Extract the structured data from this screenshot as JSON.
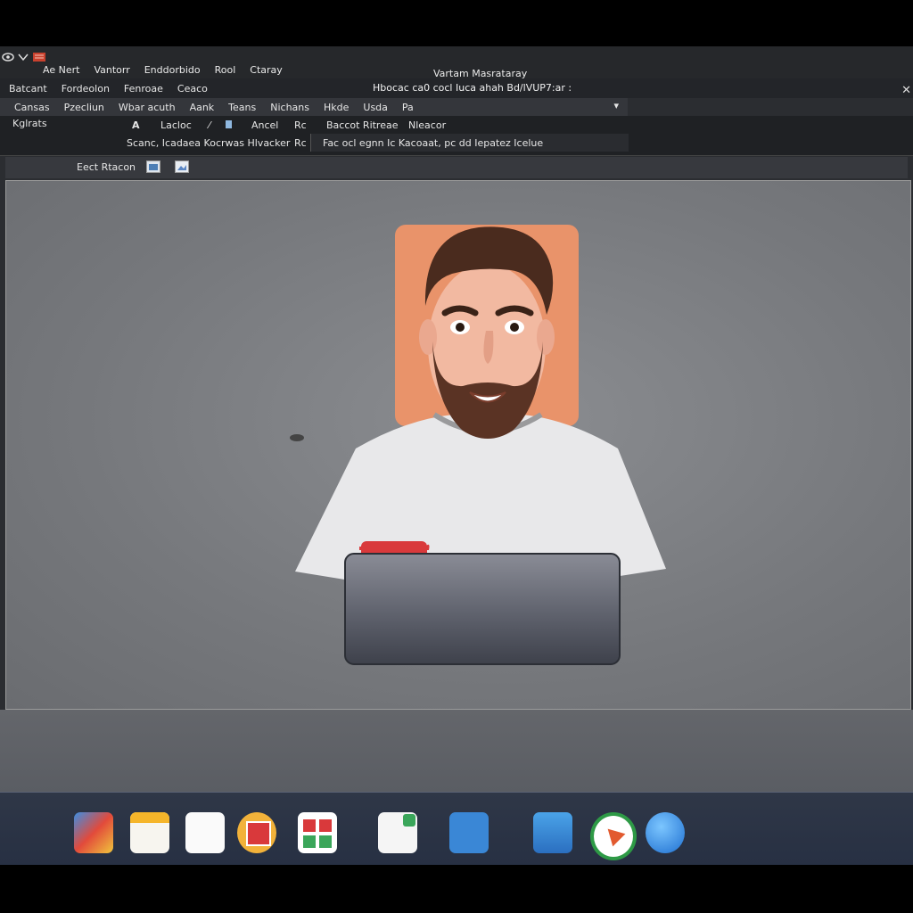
{
  "titlebar": {
    "menu": [
      "Ae Nert",
      "Vantorr",
      "Enddorbido",
      "Rool",
      "Ctaray"
    ],
    "window_title": "Vartam Masrataray"
  },
  "toolbar_row": {
    "items": [
      "Batcant",
      "Fordeolon",
      "Fenroae",
      "Ceaco"
    ],
    "address": "Hbocac ca0 cocl Iuca ahah Bd/lVUP7:ar :"
  },
  "tabs_row": {
    "items": [
      "Cansas",
      "Pzecliun",
      "Wbar acuth",
      "Aank",
      "Teans",
      "Nichans",
      "Hkde",
      "Usda",
      "Pa"
    ]
  },
  "ribbon": {
    "left_label": "Kglrats",
    "glyph_a": "A",
    "lacloc": "Lacloc",
    "arrow": "⁄",
    "ancel": "Ancel",
    "re1": "Rc",
    "bacct_ritreae": "Baccot Ritreae",
    "nleacor": "Nleacor",
    "line2": "Scanc, Icadaea Kocrwas Hlvacker",
    "re2": "Rc",
    "line3": "Fac ocl egnn Ic Kacoaat, pc dd Iepatez Icelue"
  },
  "toolbar2": {
    "label": "Eect Rtacon"
  },
  "dock": {
    "apps": [
      "photos-app-icon",
      "notes-app-icon",
      "documents-app-icon",
      "calendar-app-icon",
      "office-app-icon",
      "spreadsheet-app-icon",
      "contacts-app-icon",
      "weather-app-icon",
      "browser-app-icon",
      "help-app-icon"
    ]
  },
  "colors": {
    "accent_red": "#d9393b",
    "shirt": "#e8e8ea",
    "skin": "#f2b9a1",
    "hair": "#4a2b1e",
    "badge_orange": "#e9936a"
  }
}
